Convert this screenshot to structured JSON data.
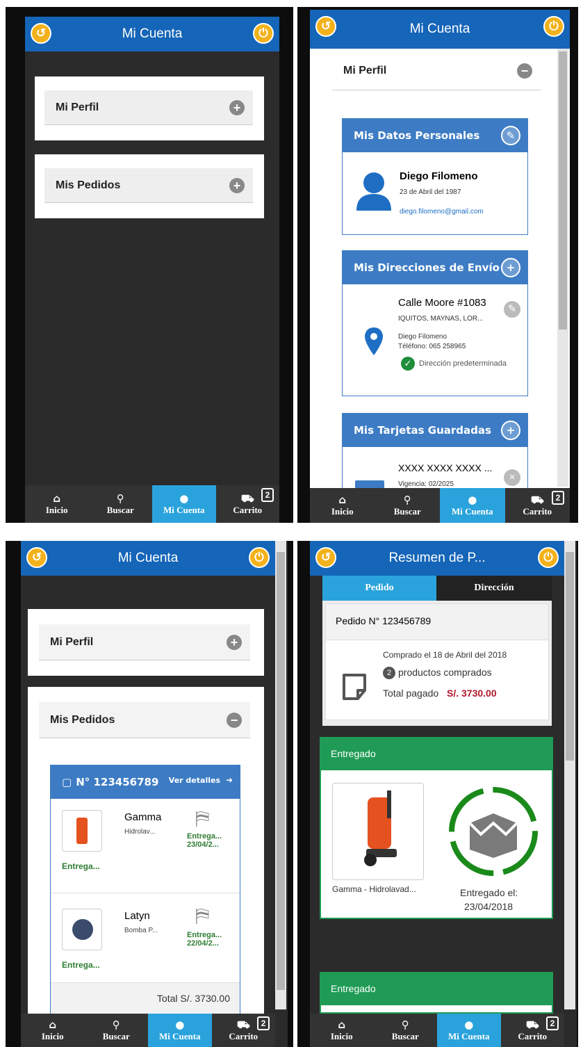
{
  "nav": {
    "items": [
      {
        "label": "Inicio",
        "icon": "home-icon"
      },
      {
        "label": "Buscar",
        "icon": "search-icon"
      },
      {
        "label": "Mi Cuenta",
        "icon": "user-icon"
      },
      {
        "label": "Carrito",
        "icon": "cart-icon"
      }
    ],
    "cart_count": "2"
  },
  "colors": {
    "header": "#1565b8",
    "accent": "#f3b21b",
    "active_tab": "#2aa3dc",
    "green": "#1f9b55",
    "price_red": "#b2182b"
  },
  "screen1": {
    "title": "Mi Cuenta",
    "sections": [
      "Mi Perfil",
      "Mis Pedidos"
    ]
  },
  "screen2": {
    "title": "Mi Cuenta",
    "section": "Mi Perfil",
    "datos": {
      "header": "Mis Datos Personales",
      "name": "Diego Filomeno",
      "birth": "23 de Abril del 1987",
      "email": "diego.filomeno@gmail.com"
    },
    "direcciones": {
      "header": "Mis Direcciones de Envío",
      "street": "Calle Moore #1083",
      "city": "IQUITOS, MAYNAS, LOR...",
      "person": "Diego Filomeno",
      "phone": "Téléfono: 065 258965",
      "default": "Dirección predeterminada"
    },
    "tarjetas": {
      "header": "Mis Tarjetas Guardadas",
      "number": "XXXX XXXX XXXX ...",
      "vigencia": "Vigencia: 02/2025"
    }
  },
  "screen3": {
    "title": "Mi Cuenta",
    "sections": [
      "Mi Perfil",
      "Mis Pedidos"
    ],
    "order": {
      "number": "N° 123456789",
      "details": "Ver detalles",
      "items": [
        {
          "brand": "Gamma",
          "desc": "Hidrolav...",
          "status": "Entrega...",
          "state": "Entrega...",
          "date": "23/04/2..."
        },
        {
          "brand": "Latyn",
          "desc": "Bomba P...",
          "status": "Entrega...",
          "state": "Entrega...",
          "date": "22/04/2..."
        }
      ],
      "total": "Total S/. 3730.00"
    }
  },
  "screen4": {
    "title": "Resumen de P...",
    "tabs": [
      "Pedido",
      "Dirección"
    ],
    "order_title": "Pedido N° 123456789",
    "purchased": "Comprado el 18 de Abril del 2018",
    "count": "2",
    "count_label": "productos comprados",
    "total_label": "Total pagado",
    "total_value": "S/. 3730.00",
    "delivered": "Entregado",
    "product_name": "Gamma - Hidrolavad...",
    "delivered_on": "Entregado el:",
    "delivered_date": "23/04/2018",
    "delivered2": "Entregado"
  }
}
